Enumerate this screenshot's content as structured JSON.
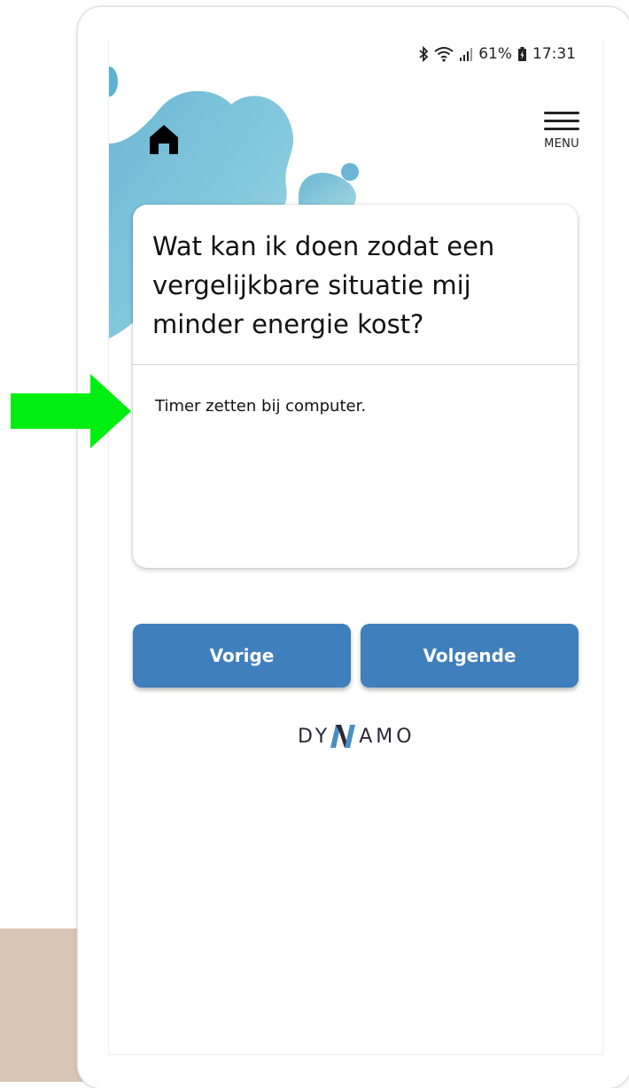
{
  "status_bar": {
    "battery": "61%",
    "time": "17:31",
    "icons": [
      "bluetooth-icon",
      "wifi-icon",
      "signal-icon",
      "battery-icon"
    ]
  },
  "header": {
    "home_icon": "home-icon",
    "menu_label": "MENU"
  },
  "card": {
    "question": "Wat kan ik doen zodat een vergelijkbare situatie mij minder energie kost?",
    "answer": "Timer zetten bij computer."
  },
  "buttons": {
    "prev_label": "Vorige",
    "next_label": "Volgende",
    "color": "#3f7fbb"
  },
  "logo": {
    "left": "DY",
    "right": "AMO"
  },
  "annotation": {
    "arrow_color": "#00ee11"
  }
}
